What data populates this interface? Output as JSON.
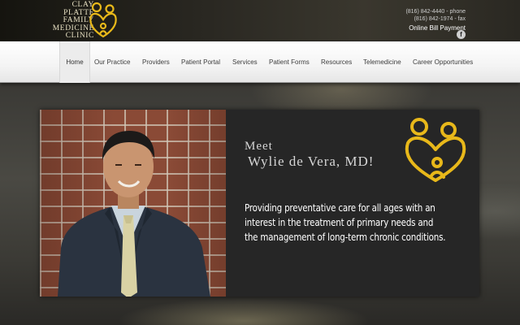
{
  "header": {
    "logo_lines": [
      "Clay",
      "Platte",
      "Family",
      "Medicine",
      "Clinic"
    ],
    "phone": "(816) 842-4440 - phone",
    "fax": "(816) 842-1974 - fax",
    "bill_payment": "Online Bill Payment",
    "facebook_glyph": "f",
    "facebook_icon": "facebook-icon"
  },
  "nav": {
    "items": [
      {
        "label": "Home",
        "active": true
      },
      {
        "label": "Our Practice"
      },
      {
        "label": "Providers"
      },
      {
        "label": "Patient Portal"
      },
      {
        "label": "Services"
      },
      {
        "label": "Patient Forms"
      },
      {
        "label": "Resources"
      },
      {
        "label": "Telemedicine"
      },
      {
        "label": "Career Opportunities"
      }
    ]
  },
  "hero": {
    "meet_line1": "Meet",
    "meet_line2": "Wylie de Vera, MD!",
    "tagline_lines": [
      "Providing preventative care for all ages with an",
      "interest in the treatment of primary needs and",
      "the management of long-term chronic conditions."
    ],
    "photo_subject": "doctor-portrait-photo"
  },
  "colors": {
    "brand_gold": "#e8b81a",
    "nav_text": "#3c3c3c",
    "hero_bg": "#262626"
  }
}
